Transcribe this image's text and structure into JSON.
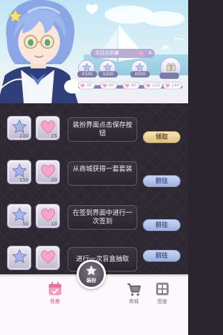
{
  "progress": {
    "today_label": "当日达到量",
    "today_value": "6",
    "rewards": [
      {
        "label": "X100"
      },
      {
        "label": "X200"
      },
      {
        "label": "X500"
      },
      {
        "label": ""
      }
    ],
    "ticks": [
      "30",
      "60",
      "90",
      "120",
      "240"
    ]
  },
  "tasks": [
    {
      "star_qty": "100",
      "heart_qty": "15",
      "text": "装扮界面点击保存按钮",
      "button": "领取",
      "state": "claim"
    },
    {
      "star_qty": "150",
      "heart_qty": "20",
      "text": "从商城获得一套套装",
      "button": "前往",
      "state": "go"
    },
    {
      "star_qty": "50",
      "heart_qty": "10",
      "text": "在签到界面中进行一次签到",
      "button": "前往",
      "state": "go"
    },
    {
      "star_qty": "",
      "heart_qty": "",
      "text": "进行一次盲盒抽取",
      "button": "前往",
      "state": "go"
    }
  ],
  "nav": {
    "tasks": "任务",
    "dress": "装扮",
    "shop": "商城",
    "album": "图鉴"
  },
  "colors": {
    "accent_pink": "#e86fa4",
    "claim_gold": "#e0c182",
    "go_blue": "#9eb0df",
    "list_bg": "#2e2833"
  }
}
